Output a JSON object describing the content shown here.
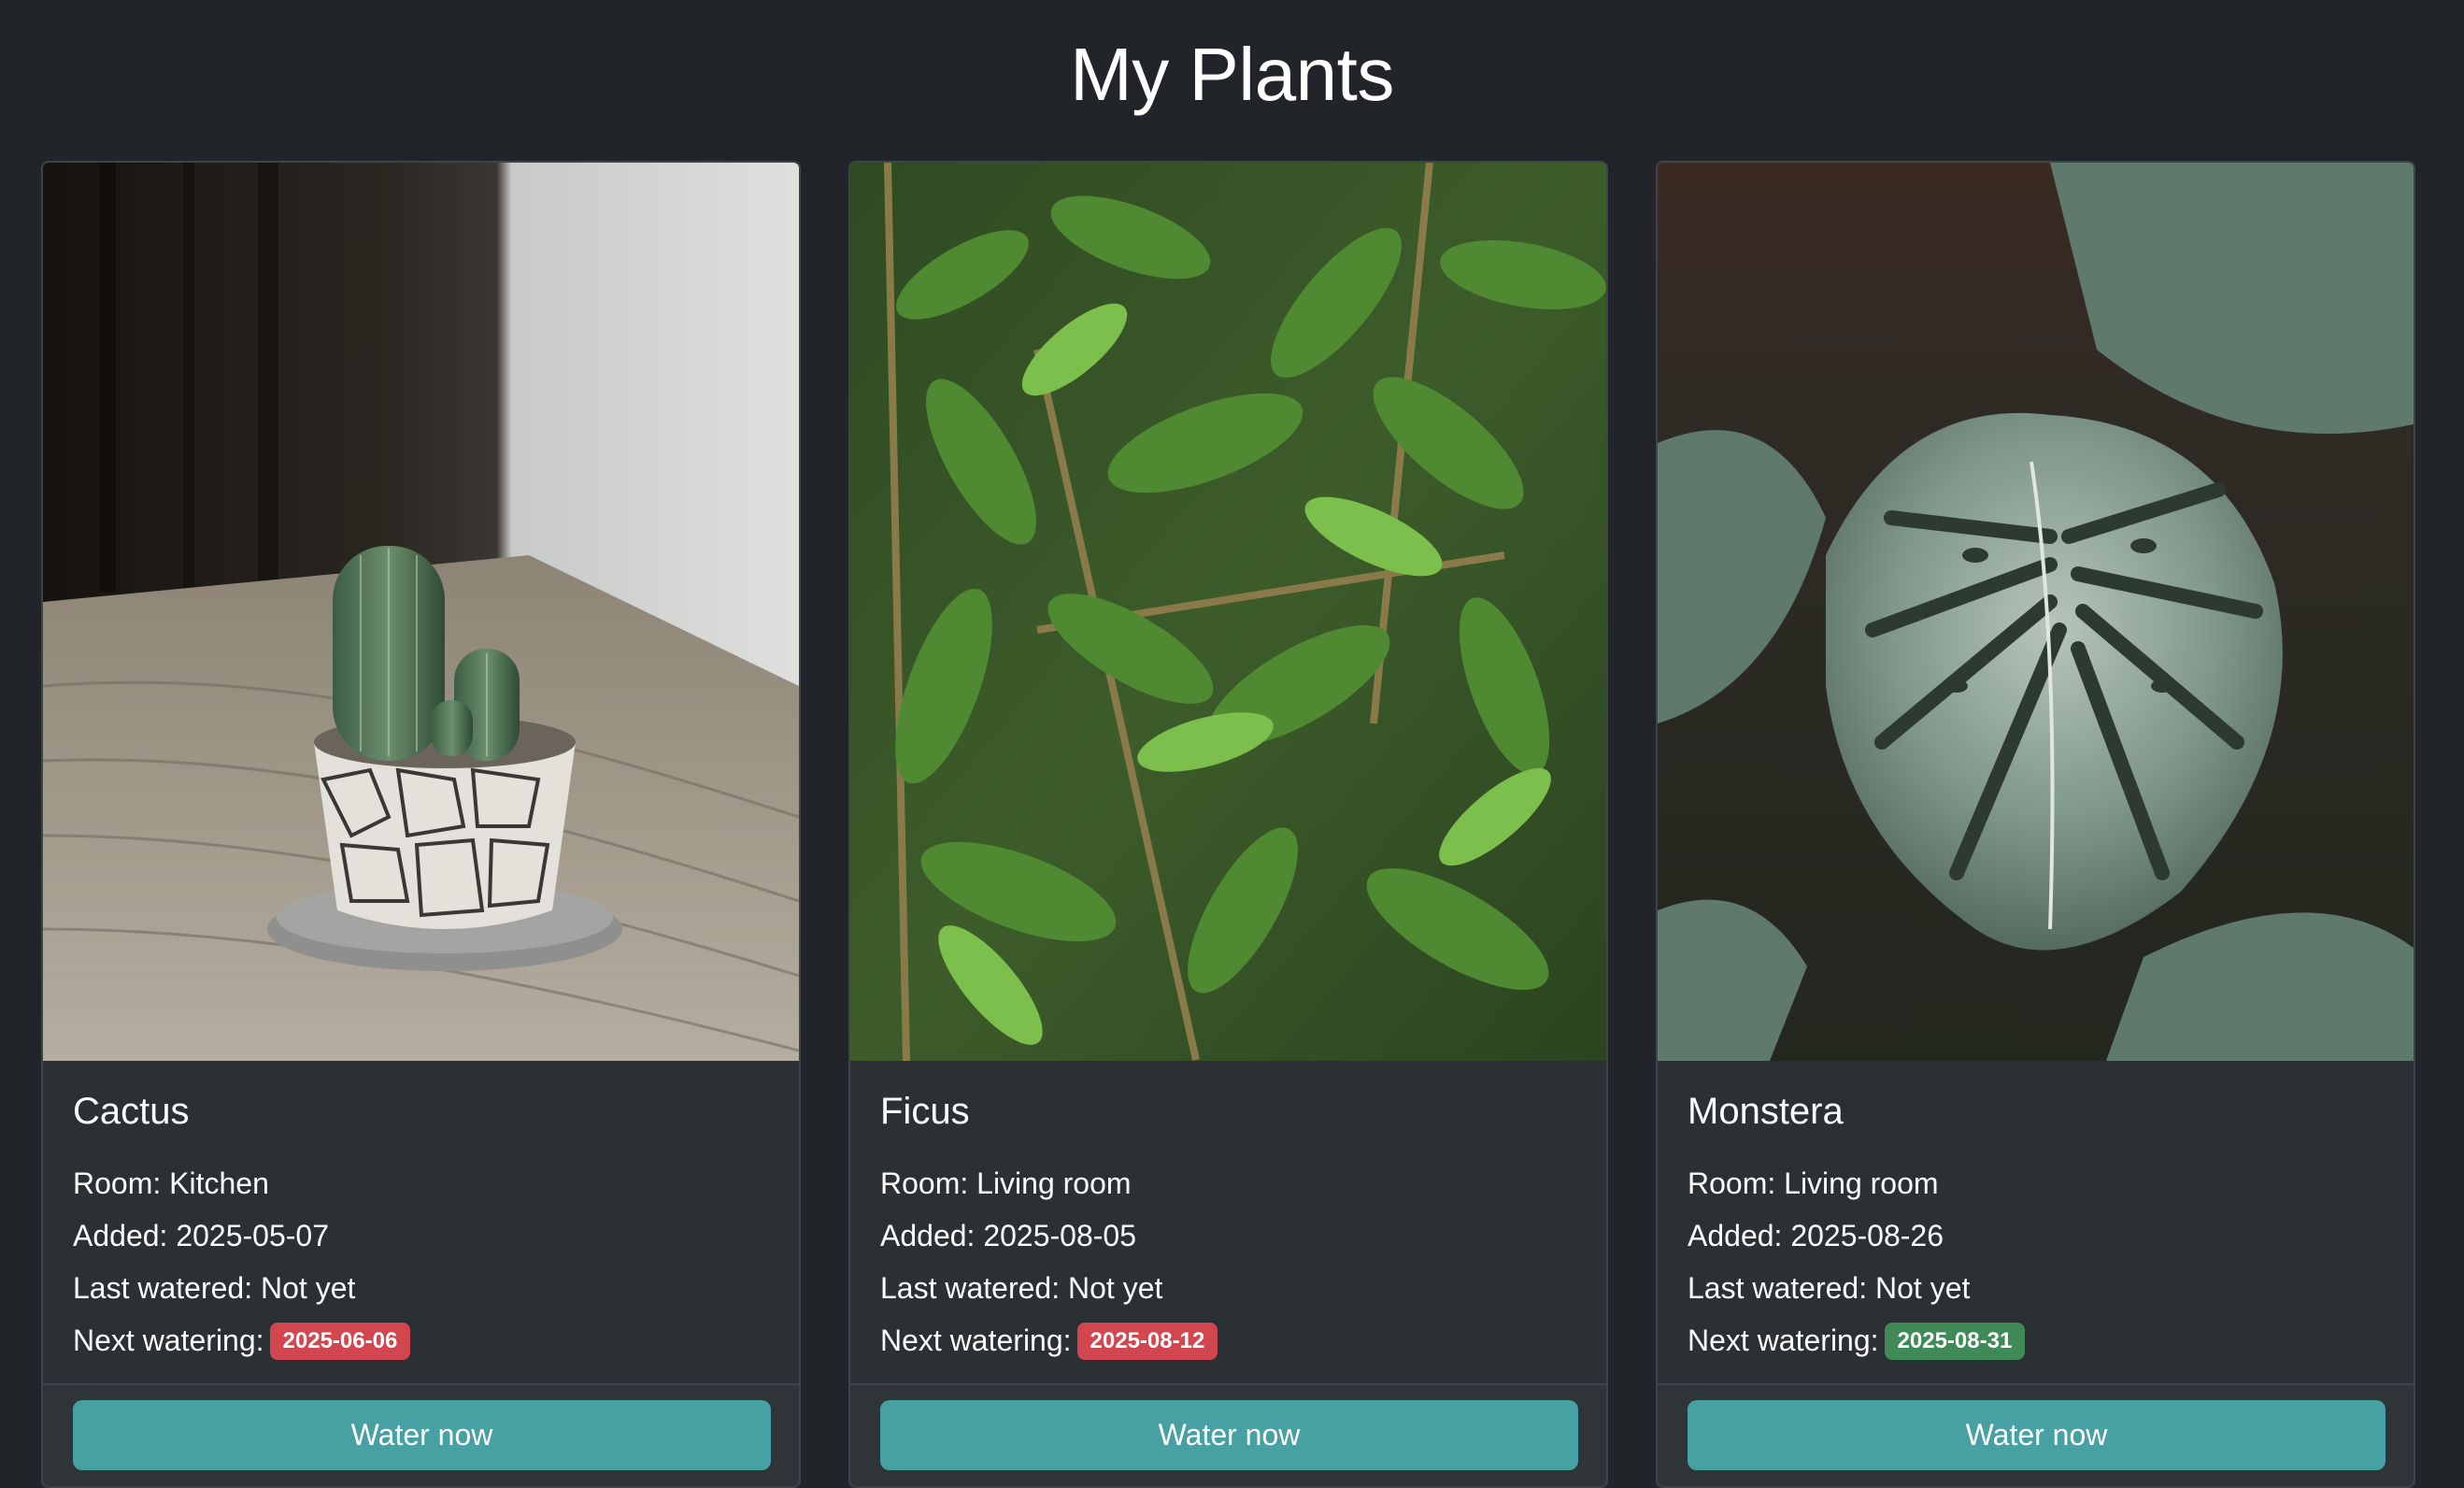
{
  "page": {
    "title": "My Plants"
  },
  "labels": {
    "room": "Room:",
    "added": "Added:",
    "last_watered": "Last watered:",
    "next_watering": "Next watering:"
  },
  "plants": [
    {
      "name": "Cactus",
      "room": "Kitchen",
      "added": "2025-05-07",
      "last_watered": "Not yet",
      "next_watering": "2025-06-06",
      "next_watering_status": "overdue",
      "badge_color": "#d2474f",
      "button_label": "Water now"
    },
    {
      "name": "Ficus",
      "room": "Living room",
      "added": "2025-08-05",
      "last_watered": "Not yet",
      "next_watering": "2025-08-12",
      "next_watering_status": "overdue",
      "badge_color": "#d2474f",
      "button_label": "Water now"
    },
    {
      "name": "Monstera",
      "room": "Living room",
      "added": "2025-08-26",
      "last_watered": "Not yet",
      "next_watering": "2025-08-31",
      "next_watering_status": "upcoming",
      "badge_color": "#3f8a57",
      "button_label": "Water now"
    }
  ],
  "colors": {
    "background": "#212529",
    "card": "#2b3035",
    "accent_button": "#47a0a2",
    "overdue": "#d2474f",
    "ok": "#3f8a57"
  }
}
